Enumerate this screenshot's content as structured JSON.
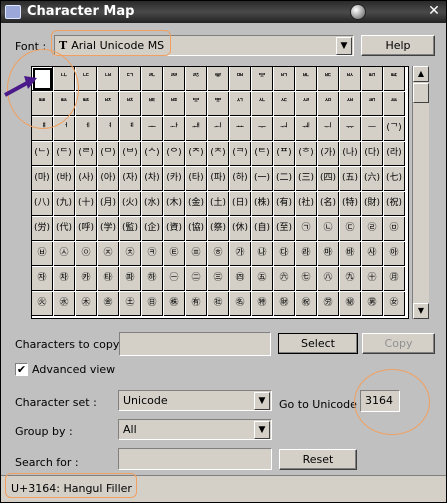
{
  "window": {
    "title": "Character Map",
    "close_glyph": "✕"
  },
  "font_row": {
    "label": "Font :",
    "value": "Arial Unicode MS",
    "font_type_glyph": "T",
    "help_label": "Help"
  },
  "grid": {
    "rows": [
      [
        "",
        "ᄔ",
        "ᄕ",
        "ᄖ",
        "ᄗ",
        "ᄘ",
        "ᄙ",
        "ᄚ",
        "ᄛ",
        "ᄜ",
        "ᄝ",
        "ᄞ",
        "ᄟ",
        "ᄠ",
        "ᄡ",
        "ᄢ",
        "ᄣ"
      ],
      [
        "ᄤ",
        "ᄥ",
        "ᄦ",
        "ᄧ",
        "ᄨ",
        "ᄩ",
        "ᄪ",
        "ᄫ",
        "ᄬ",
        "ᄭ",
        "ᄮ",
        "ᄯ",
        "ᄰ",
        "ᄱ",
        "ᄲ",
        "ᄳ",
        "ᄴ"
      ],
      [
        "ᅤ",
        "ᅥ",
        "ᅦ",
        "ᅧ",
        "ᅨ",
        "ᅩ",
        "ᅪ",
        "ᅫ",
        "ᅬ",
        "ᅭ",
        "ᅮ",
        "ᅯ",
        "ᅰ",
        "ᅱ",
        "ᅲ",
        "ᅳ",
        "(ᄀ)"
      ],
      [
        "(ᄂ)",
        "(ᄃ)",
        "(ᄅ)",
        "(ᄆ)",
        "(ᄇ)",
        "(ᄉ)",
        "(ᄋ)",
        "(ᄌ)",
        "(ᄎ)",
        "(ᄏ)",
        "(ᄐ)",
        "(ᄑ)",
        "(ᄒ)",
        "(가)",
        "(나)",
        "(다)",
        "(라)"
      ],
      [
        "(마)",
        "(바)",
        "(사)",
        "(아)",
        "(자)",
        "(차)",
        "(카)",
        "(타)",
        "(파)",
        "(하)",
        "(一)",
        "(二)",
        "(三)",
        "(四)",
        "(五)",
        "(六)",
        "(七)"
      ],
      [
        "(八)",
        "(九)",
        "(十)",
        "(月)",
        "(火)",
        "(水)",
        "(木)",
        "(金)",
        "(土)",
        "(日)",
        "(株)",
        "(有)",
        "(社)",
        "(名)",
        "(特)",
        "(財)",
        "(祝)"
      ],
      [
        "(労)",
        "(代)",
        "(呼)",
        "(学)",
        "(監)",
        "(企)",
        "(資)",
        "(協)",
        "(祭)",
        "(休)",
        "(自)",
        "(至)",
        "㉠",
        "㉡",
        "㉢",
        "㉣",
        "㉤"
      ],
      [
        "㉥",
        "㉦",
        "㉧",
        "㉨",
        "㉩",
        "㉪",
        "㉫",
        "㉬",
        "㉭",
        "㉮",
        "㉯",
        "㉰",
        "㉱",
        "㉲",
        "㉳",
        "㉴",
        "㉵"
      ],
      [
        "㉶",
        "㉷",
        "㉸",
        "㉹",
        "㉺",
        "㉻",
        "㊀",
        "㊁",
        "㊂",
        "㊃",
        "㊄",
        "㊅",
        "㊆",
        "㊇",
        "㊈",
        "㊉",
        "㊊"
      ],
      [
        "㊋",
        "㊌",
        "㊍",
        "㊎",
        "㊏",
        "㊐",
        "㊑",
        "㊒",
        "㊓",
        "㊔",
        "㊕",
        "㊖",
        "㊗",
        "㊘",
        "㊙",
        "㊚",
        "㊛"
      ]
    ],
    "selected_index": 0
  },
  "copy_row": {
    "label": "Characters to copy :",
    "value": "",
    "select_label": "Select",
    "copy_label": "Copy"
  },
  "advanced": {
    "label": "Advanced view",
    "checked": "✔"
  },
  "charset_row": {
    "label": "Character set :",
    "value": "Unicode",
    "goto_label": "Go to Unicode :",
    "goto_value": "3164"
  },
  "groupby_row": {
    "label": "Group by :",
    "value": "All"
  },
  "search_row": {
    "label": "Search for :",
    "value": "",
    "reset_label": "Reset"
  },
  "status": {
    "text": "U+3164: Hangul Filler"
  },
  "colors": {
    "highlight": "#f0a060",
    "arrow": "#4a1a8a"
  }
}
